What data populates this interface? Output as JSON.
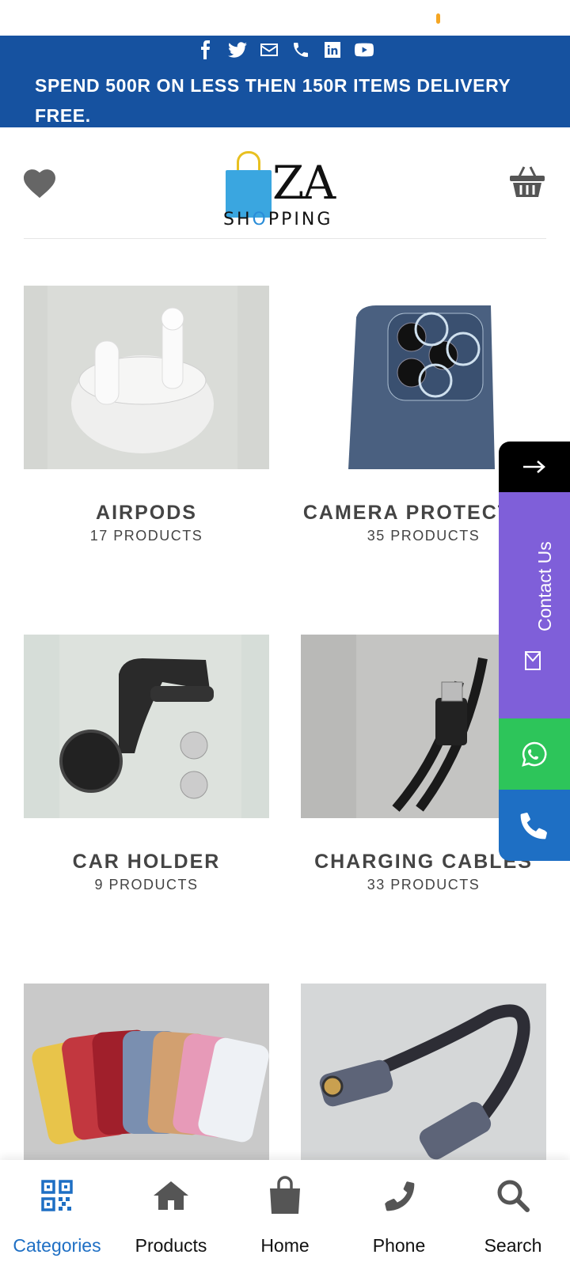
{
  "topbar": {
    "social_icons": [
      "facebook-icon",
      "twitter-icon",
      "mail-icon",
      "phone-icon",
      "linkedin-icon",
      "youtube-icon"
    ],
    "promo_text": "SPEND 500R ON LESS THEN 150R ITEMS DELIVERY FREE.",
    "bg_color": "#1652a0"
  },
  "header": {
    "logo_text_main": "ZA",
    "logo_text_sub_1": "SH",
    "logo_text_sub_o": "O",
    "logo_text_sub_2": "PPING"
  },
  "categories": [
    {
      "name": "AIRPODS",
      "count": "17 PRODUCTS"
    },
    {
      "name": "CAMERA PROTECTOR",
      "count": "35 PRODUCTS"
    },
    {
      "name": "CAR HOLDER",
      "count": "9 PRODUCTS"
    },
    {
      "name": "CHARGING CABLES",
      "count": "33 PRODUCTS"
    },
    {
      "name": "",
      "count": ""
    },
    {
      "name": "",
      "count": ""
    }
  ],
  "floating": {
    "contact_label": "Contact Us",
    "colors": {
      "arrow": "#000000",
      "contact": "#7f5fd9",
      "whatsapp": "#2dc55a",
      "phone": "#1e6fc4"
    }
  },
  "bottom_nav": {
    "items": [
      {
        "label": "Categories",
        "icon": "qr-code-icon",
        "active": true
      },
      {
        "label": "Products",
        "icon": "home-icon",
        "active": false
      },
      {
        "label": "Home",
        "icon": "shopping-bag-icon",
        "active": false
      },
      {
        "label": "Phone",
        "icon": "phone-icon",
        "active": false
      },
      {
        "label": "Search",
        "icon": "search-icon",
        "active": false
      }
    ],
    "active_color": "#1e6fc4"
  }
}
